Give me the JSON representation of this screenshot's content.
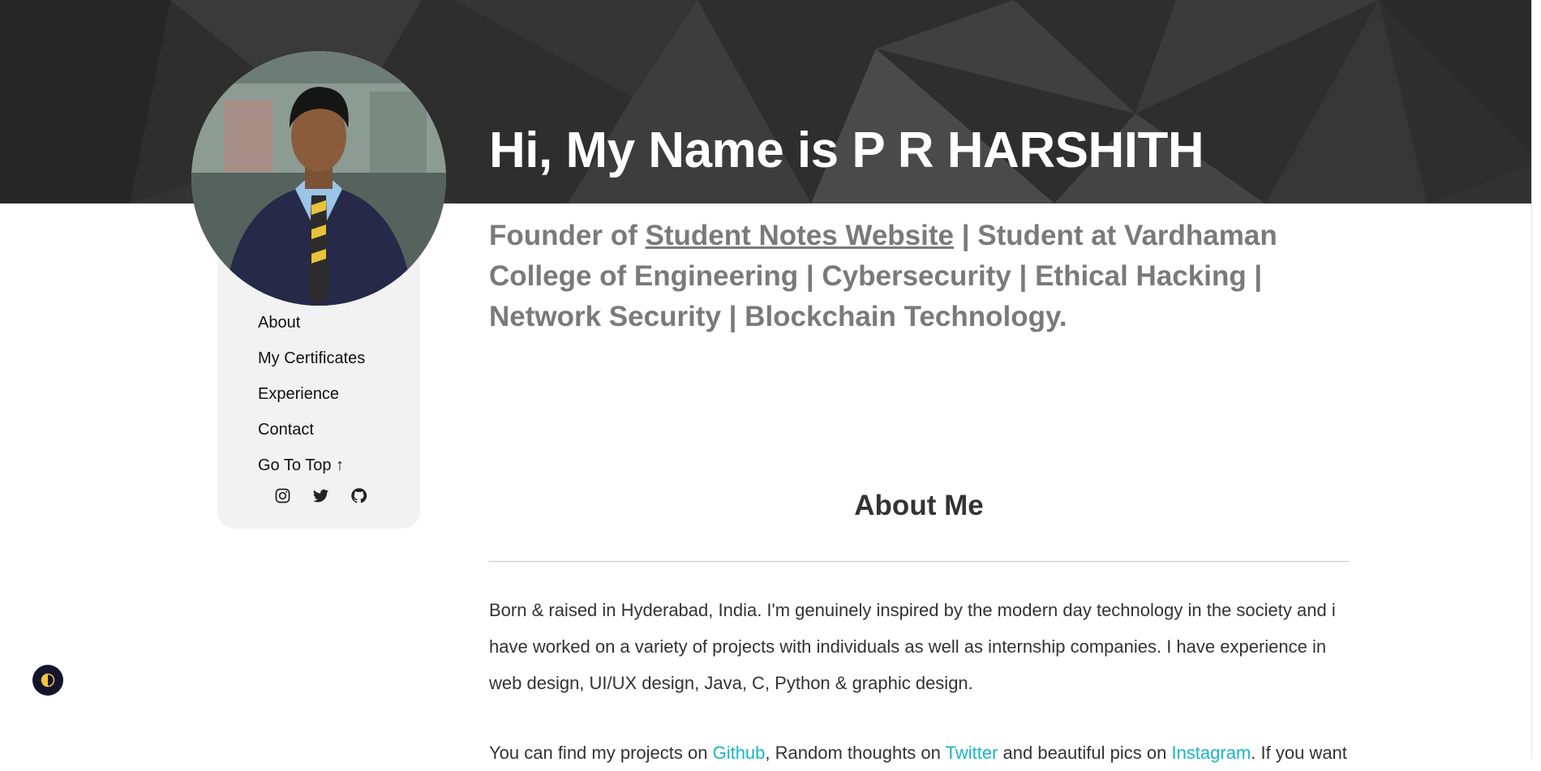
{
  "hero": {
    "title": "Hi, My Name is P R HARSHITH"
  },
  "tagline": {
    "prefix": "Founder of ",
    "link_text": "Student Notes Website",
    "suffix": " | Student at Vardhaman College of Engineering | Cybersecurity | Ethical Hacking | Network Security | Blockchain Technology."
  },
  "sidebar": {
    "nav": [
      {
        "label": "About"
      },
      {
        "label": "My Certificates"
      },
      {
        "label": "Experience"
      },
      {
        "label": "Contact"
      },
      {
        "label": "Go To Top ↑"
      }
    ],
    "social_icons": [
      "instagram-icon",
      "twitter-icon",
      "github-icon"
    ]
  },
  "about": {
    "title": "About Me",
    "paragraph1": "Born & raised in Hyderabad, India. I'm genuinely inspired by the modern day technology in the society and i have worked on a variety of projects with individuals as well as internship companies. I have experience in web design, UI/UX design, Java, C, Python & graphic design.",
    "p2_part1": "You can find my projects on ",
    "p2_link1": "Github",
    "p2_part2": ", Random thoughts on ",
    "p2_link2": "Twitter",
    "p2_part3": " and beautiful pics on ",
    "p2_link3": "Instagram",
    "p2_part4": ". If you want"
  },
  "colors": {
    "hero_bg": "#2f2f2f",
    "link_accent": "#17b6c8",
    "tagline": "#7a7a7a",
    "toggle_bg": "#14142b",
    "toggle_accent": "#f5c542"
  }
}
